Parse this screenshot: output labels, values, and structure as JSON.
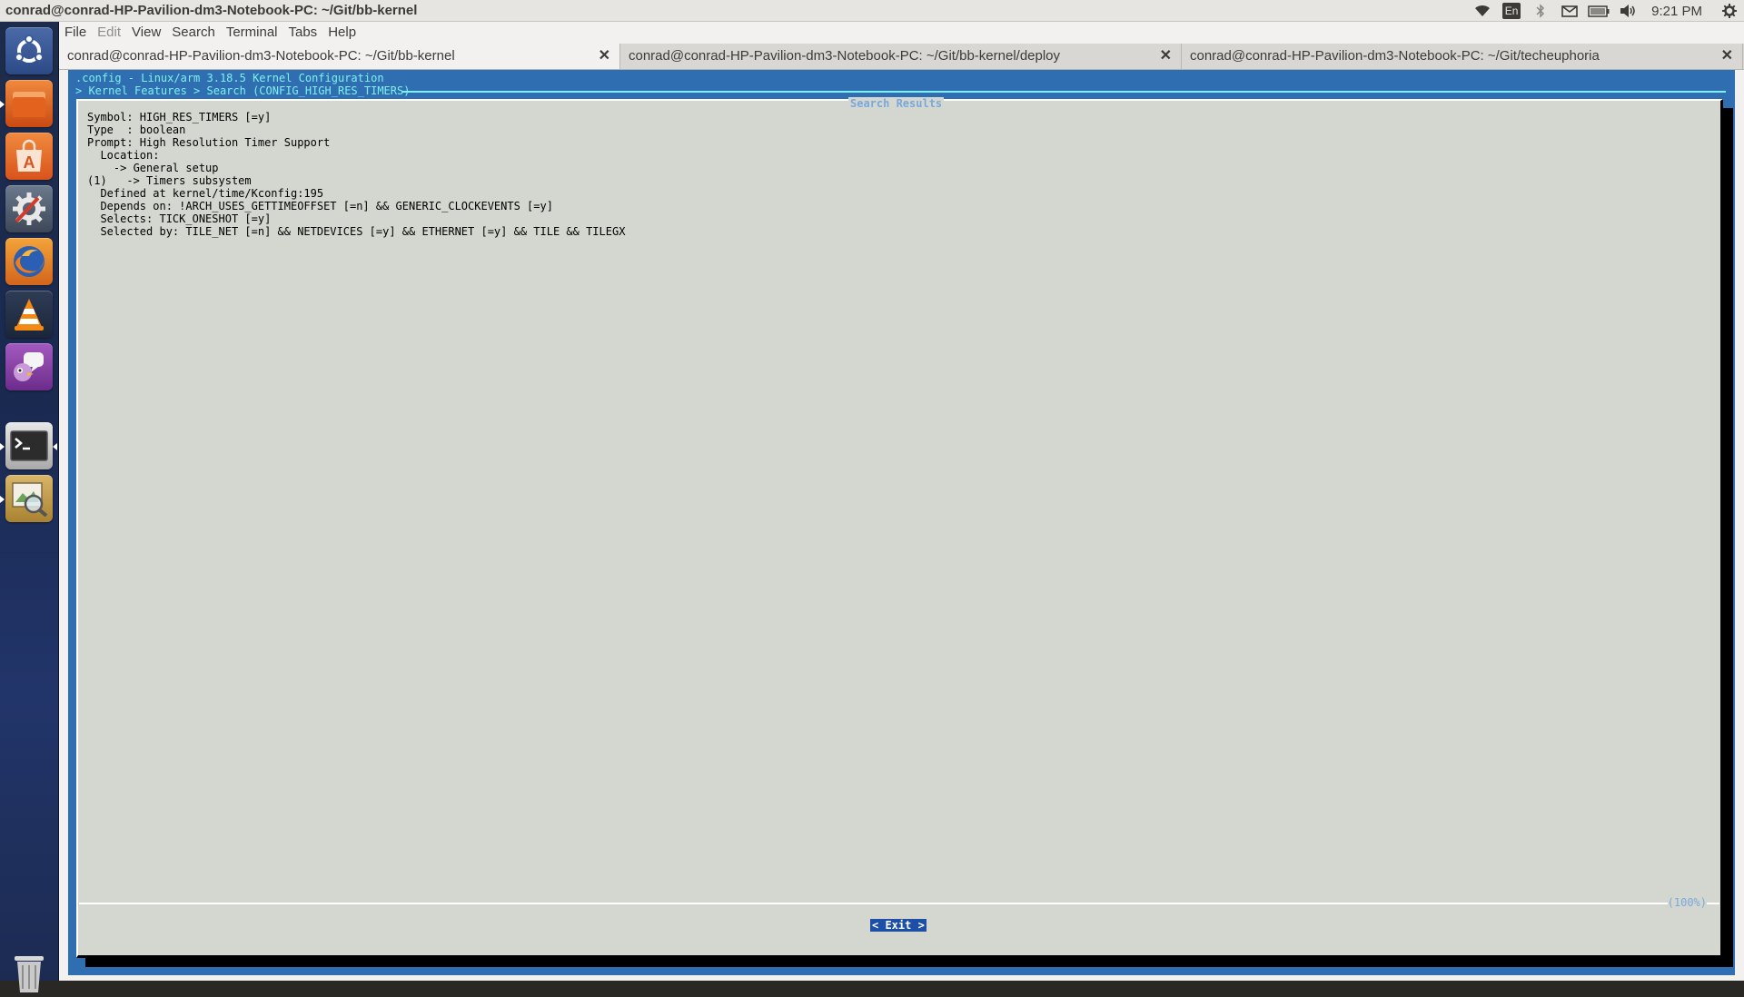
{
  "window_title": "conrad@conrad-HP-Pavilion-dm3-Notebook-PC: ~/Git/bb-kernel",
  "indicators": {
    "icons": [
      "wifi-icon",
      "keyboard-layout-icon",
      "bluetooth-icon",
      "mail-icon",
      "battery-icon",
      "volume-icon",
      "session-gear-icon"
    ],
    "language": "En",
    "clock": "9:21 PM"
  },
  "launcher": {
    "items": [
      "ubuntu-dash",
      "files",
      "software-center",
      "system-settings",
      "firefox",
      "vlc",
      "pidgin",
      "terminal",
      "image-viewer",
      "trash"
    ]
  },
  "menu": [
    "File",
    "Edit",
    "View",
    "Search",
    "Terminal",
    "Tabs",
    "Help"
  ],
  "tabs": [
    {
      "label": "conrad@conrad-HP-Pavilion-dm3-Notebook-PC: ~/Git/bb-kernel",
      "active": true
    },
    {
      "label": "conrad@conrad-HP-Pavilion-dm3-Notebook-PC: ~/Git/bb-kernel/deploy",
      "active": false
    },
    {
      "label": "conrad@conrad-HP-Pavilion-dm3-Notebook-PC: ~/Git/techeuphoria",
      "active": false
    }
  ],
  "tab_close_glyph": "✕",
  "menuconfig": {
    "title": ".config - Linux/arm 3.18.5 Kernel Configuration",
    "breadcrumb": "> Kernel Features > Search (CONFIG_HIGH_RES_TIMERS) ",
    "dialog_title": "Search Results",
    "lines": [
      "Symbol: HIGH_RES_TIMERS [=y]",
      "Type  : boolean",
      "Prompt: High Resolution Timer Support",
      "  Location:",
      "    -> General setup",
      "(1)   -> Timers subsystem",
      "  Defined at kernel/time/Kconfig:195",
      "  Depends on: !ARCH_USES_GETTIMEOFFSET [=n] && GENERIC_CLOCKEVENTS [=y]",
      "  Selects: TICK_ONESHOT [=y]",
      "  Selected by: TILE_NET [=n] && NETDEVICES [=y] && ETHERNET [=y] && TILE && TILEGX"
    ],
    "scroll_percent": "(100%)",
    "exit_button": "< Exit >"
  },
  "colors": {
    "terminal_bg": "#2f6fb1",
    "dialog_bg": "#d3d7cf",
    "title_cyan": "#7ef0f0",
    "accent_blue": "#7aa8dc",
    "button_bg": "#1d4fa6"
  }
}
